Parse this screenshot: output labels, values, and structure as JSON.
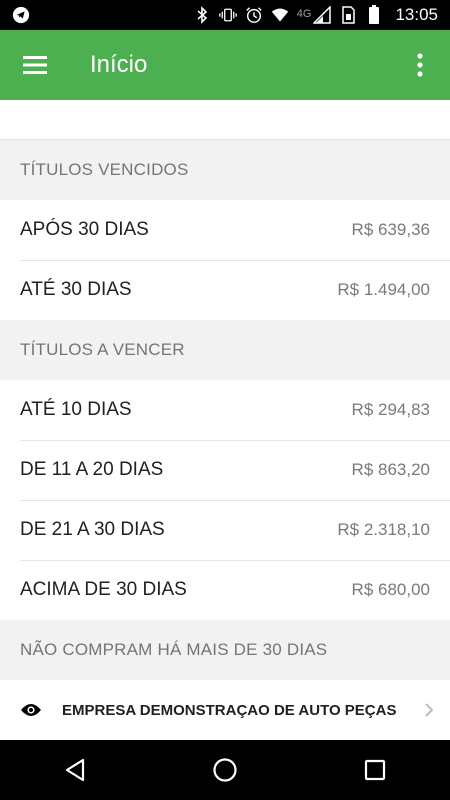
{
  "status_bar": {
    "time": "13:05",
    "network_label": "4G",
    "icons": [
      "telegram-icon",
      "bluetooth-icon",
      "vibrate-icon",
      "alarm-icon",
      "wifi-icon",
      "cell-signal-icon",
      "sim-icon",
      "battery-icon"
    ]
  },
  "app_bar": {
    "title": "Início",
    "accent_color": "#4caf50"
  },
  "sections": {
    "overdue": {
      "header": "TÍTULOS VENCIDOS",
      "rows": [
        {
          "label": "APÓS 30 DIAS",
          "value": "R$ 639,36"
        },
        {
          "label": "ATÉ 30 DIAS",
          "value": "R$ 1.494,00"
        }
      ]
    },
    "upcoming": {
      "header": "TÍTULOS A VENCER",
      "rows": [
        {
          "label": "ATÉ 10 DIAS",
          "value": "R$ 294,83"
        },
        {
          "label": "DE 11 A 20 DIAS",
          "value": "R$ 863,20"
        },
        {
          "label": "DE 21 A 30 DIAS",
          "value": "R$ 2.318,10"
        },
        {
          "label": "ACIMA DE 30 DIAS",
          "value": "R$ 680,00"
        }
      ]
    },
    "inactive_customers": {
      "header": "NÃO COMPRAM HÁ MAIS DE 30 DIAS",
      "rows": [
        {
          "name": "EMPRESA DEMONSTRAÇAO DE AUTO PEÇAS",
          "icon": "eye-icon"
        }
      ]
    }
  },
  "nav_bar": {
    "buttons": [
      "back-icon",
      "home-icon",
      "recents-icon"
    ]
  }
}
